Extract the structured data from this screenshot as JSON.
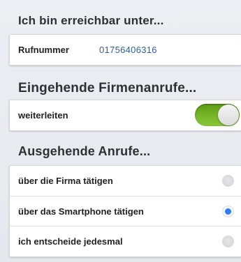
{
  "sections": {
    "reachable": {
      "title": "Ich bin erreichbar unter...",
      "phone_label": "Rufnummer",
      "phone_value": "01756406316"
    },
    "incoming": {
      "title": "Eingehende Firmenanrufe...",
      "forward_label": "weiterleiten",
      "forward_enabled": true
    },
    "outgoing": {
      "title": "Ausgehende Anrufe...",
      "options": [
        {
          "label": "über die Firma tätigen",
          "selected": false
        },
        {
          "label": "über das Smartphone tätigen",
          "selected": true
        },
        {
          "label": "ich entscheide jedesmal",
          "selected": false
        }
      ]
    }
  },
  "colors": {
    "toggle_on": "#77b729",
    "radio_selected": "#2f7df0",
    "phone_text": "#2f5f97"
  }
}
